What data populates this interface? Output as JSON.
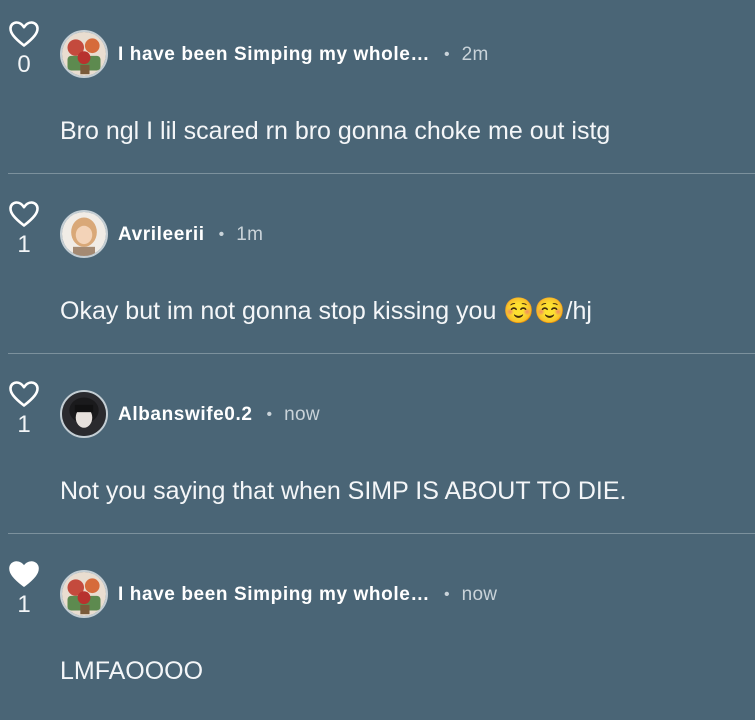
{
  "comments": [
    {
      "likes": "0",
      "liked": false,
      "username": "I have been Simping my whole…",
      "time": "2m",
      "text": "Bro ngl I lil scared rn bro gonna choke me out istg"
    },
    {
      "likes": "1",
      "liked": false,
      "username": "Avrileerii",
      "time": "1m",
      "text": "Okay but im not gonna stop kissing you ☺️☺️/hj"
    },
    {
      "likes": "1",
      "liked": false,
      "username": "Albanswife0.2",
      "time": "now",
      "text": "Not you saying that when SIMP IS ABOUT TO DIE."
    },
    {
      "likes": "1",
      "liked": true,
      "username": "I have been Simping my whole…",
      "time": "now",
      "text": "LMFAOOOO"
    }
  ],
  "separator": "•",
  "icons": {
    "like_outline": "heart-outline-icon",
    "like_filled": "heart-filled-icon"
  },
  "colors": {
    "background": "#4a6576",
    "text": "#ffffff",
    "muted": "#c9d3d9",
    "divider": "#7c919d"
  }
}
